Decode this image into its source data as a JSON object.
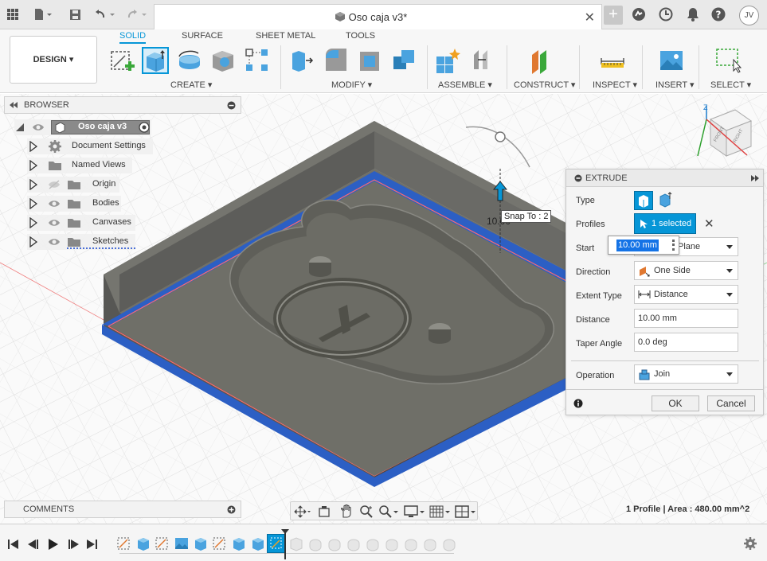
{
  "titlebar": {
    "doc_title": "Oso caja v3*",
    "avatar": "JV"
  },
  "ribbon": {
    "workspace": "DESIGN ▾",
    "tabs": [
      {
        "label": "SOLID",
        "active": true
      },
      {
        "label": "SURFACE",
        "active": false
      },
      {
        "label": "SHEET METAL",
        "active": false
      },
      {
        "label": "TOOLS",
        "active": false
      }
    ],
    "groups": [
      "CREATE ▾",
      "MODIFY ▾",
      "ASSEMBLE ▾",
      "CONSTRUCT ▾",
      "INSPECT ▾",
      "INSERT ▾",
      "SELECT ▾"
    ]
  },
  "browser": {
    "title": "BROWSER",
    "items": [
      {
        "label": "Oso caja v3"
      },
      {
        "label": "Document Settings"
      },
      {
        "label": "Named Views"
      },
      {
        "label": "Origin"
      },
      {
        "label": "Bodies"
      },
      {
        "label": "Canvases"
      },
      {
        "label": "Sketches"
      }
    ]
  },
  "viewport": {
    "manipulator_value": "10.00",
    "snap_tooltip": "Snap To : 2",
    "viewcube_front": "FRONT",
    "viewcube_right": "RIGHT",
    "axis_z": "Z"
  },
  "extrude": {
    "title": "EXTRUDE",
    "type_label": "Type",
    "profiles_label": "Profiles",
    "profiles_value": "1 selected",
    "start_label": "Start",
    "start_value": "Plane",
    "start_input": "10.00 mm",
    "direction_label": "Direction",
    "direction_value": "One Side",
    "extent_label": "Extent Type",
    "extent_value": "Distance",
    "distance_label": "Distance",
    "distance_value": "10.00 mm",
    "taper_label": "Taper Angle",
    "taper_value": "0.0 deg",
    "operation_label": "Operation",
    "operation_value": "Join",
    "ok": "OK",
    "cancel": "Cancel"
  },
  "comments": {
    "title": "COMMENTS"
  },
  "status": {
    "text": "1 Profile | Area : 480.00 mm^2"
  },
  "colors": {
    "accent": "#0696d7",
    "profile_blue": "#2c5fc4",
    "body_gray": "#6b6b67"
  }
}
